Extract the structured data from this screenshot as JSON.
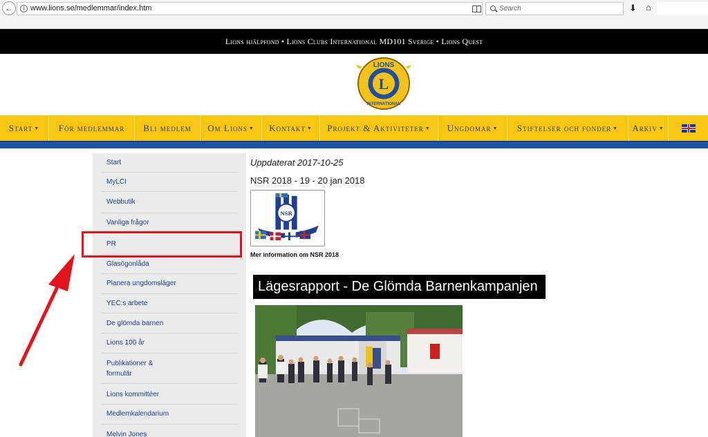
{
  "browser": {
    "url": "www.lions.se/medlemmar/index.htm",
    "search_placeholder": "Search"
  },
  "topbar": {
    "text": "Lions hjälpfond • Lions Clubs International MD101 Sverige • Lions Quest"
  },
  "logo": {
    "top_text": "LIONS",
    "center": "L",
    "bottom_text": "INTERNATIONAL"
  },
  "nav": {
    "items": [
      {
        "label": "Start",
        "dropdown": true
      },
      {
        "label": "För medlemmar",
        "dropdown": false
      },
      {
        "label": "Bli medlem",
        "dropdown": false
      },
      {
        "label": "Om Lions",
        "dropdown": true
      },
      {
        "label": "Kontakt",
        "dropdown": true
      },
      {
        "label": "Projekt & Aktiviteter",
        "dropdown": true
      },
      {
        "label": "Ungdomar",
        "dropdown": true
      },
      {
        "label": "Stiftelser och fonder",
        "dropdown": true
      },
      {
        "label": "Arkiv",
        "dropdown": true
      }
    ],
    "caret": "▼"
  },
  "sidebar": {
    "items": [
      {
        "label": "Start"
      },
      {
        "label": "MyLCI"
      },
      {
        "label": "Webbutik"
      },
      {
        "label": "Vanliga frågor"
      },
      {
        "label": "PR"
      },
      {
        "label": "Glasögonlåda"
      },
      {
        "label": "Planera ungdomsläger"
      },
      {
        "label": "YEC:s arbete"
      },
      {
        "label": "De glömda barnen"
      },
      {
        "label": "Lions 100 år"
      },
      {
        "label": "Publikationer &"
      },
      {
        "label": "formulär"
      },
      {
        "label": "Lions kommittéer"
      },
      {
        "label": "Medlemkalendarium"
      },
      {
        "label": "Melvin Jones"
      }
    ]
  },
  "content": {
    "updated": "Uppdaterat 2017-10-25",
    "nsr_title": "NSR 2018 - 19 - 20 jan 2018",
    "nsr_badge": "NSR",
    "nsr_link": "Mer information om NSR 2018",
    "headline": "Lägesrapport - De Glömda Barnenkampanjen"
  },
  "colors": {
    "nav_yellow": "#f8c612",
    "nav_text": "#2b3d7d",
    "strip_blue": "#1f53a5",
    "annotation_red": "#e3141a"
  }
}
